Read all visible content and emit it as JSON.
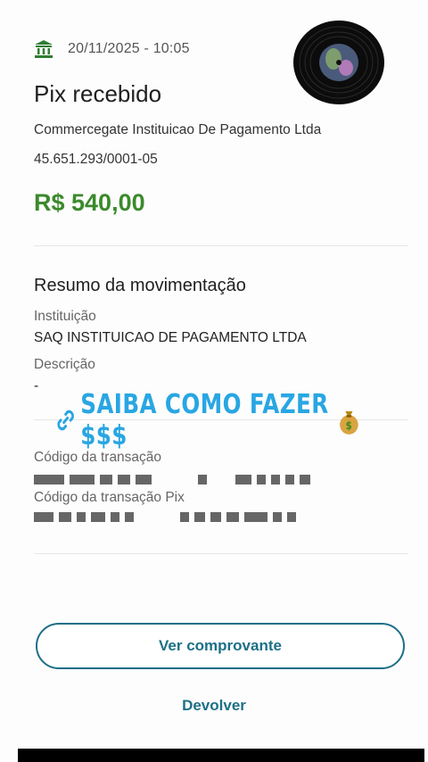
{
  "header": {
    "datetime": "20/11/2025 - 10:05"
  },
  "transaction": {
    "title": "Pix recebido",
    "payer_name": "Commercegate Instituicao De Pagamento Ltda",
    "payer_document": "45.651.293/0001-05",
    "amount": "R$ 540,00"
  },
  "summary": {
    "title": "Resumo da movimentação",
    "institution_label": "Instituição",
    "institution_value": "SAQ INSTITUICAO DE PAGAMENTO LTDA",
    "description_label": "Descrição",
    "description_value": "-",
    "transaction_code_label": "Código da transação",
    "pix_code_label": "Código da transação Pix"
  },
  "overlay": {
    "text": "SAIBA COMO FAZER $$$"
  },
  "actions": {
    "receipt_label": "Ver comprovante",
    "refund_label": "Devolver"
  },
  "colors": {
    "amount": "#3b8a2c",
    "action": "#1d6f87",
    "overlay": "#29a6e3"
  },
  "icons": [
    "bank-icon",
    "vinyl-record-icon",
    "link-icon",
    "money-bag-icon"
  ]
}
